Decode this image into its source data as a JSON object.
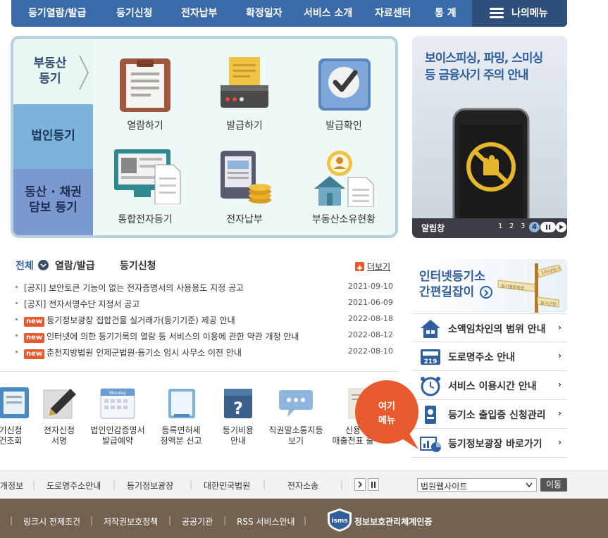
{
  "nav": {
    "items": [
      "등기열람/발급",
      "등기신청",
      "전자납부",
      "확정일자",
      "서비스 소개",
      "자료센터",
      "통 계"
    ],
    "my_menu": "나의메뉴"
  },
  "panel": {
    "tabs": {
      "real_estate": "부동산\n등기",
      "corporate": "법인등기",
      "movable": "동산 · 채권\n담보 등기"
    },
    "services": [
      "열람하기",
      "발급하기",
      "발급확인",
      "통합전자등기",
      "전자납부",
      "부동산소유현황"
    ]
  },
  "banner": {
    "headline": "보이스피싱, 파밍, 스미싱\n등 금융사기 주의 안내",
    "bar_label": "알림창",
    "pages": [
      "1",
      "2",
      "3",
      "4"
    ],
    "current_page": "4"
  },
  "notices": {
    "tabs": [
      "전체",
      "열람/발급",
      "등기신청"
    ],
    "more": "더보기",
    "new_label": "new",
    "items": [
      {
        "text": "[공지] 보안토큰 기능이 없는 전자증명서의 사용용도 지정 공고",
        "date": "2021-09-10",
        "is_new": false
      },
      {
        "text": "[공지] 전자서명수단 지정서 공고",
        "date": "2021-06-09",
        "is_new": false
      },
      {
        "text": "등기정보광장 집합건물 실거래가(등기기준) 제공 안내",
        "date": "2022-08-18",
        "is_new": true
      },
      {
        "text": "인터넷에 의한 등기기록의 열람 등 서비스의 이용에 관한 약관 개정 안내",
        "date": "2022-08-12",
        "is_new": true
      },
      {
        "text": "춘천지방법원 인제군법원·등기소 임시 사무소 이전 안내",
        "date": "2022-08-10",
        "is_new": true
      }
    ]
  },
  "guide": {
    "title": "인터넷등기소\n간편길잡이",
    "sign_texts": [
      "인터넷등기",
      "등기열람발급",
      "등기신청"
    ]
  },
  "right_links": [
    "소액임차인의 범위 안내",
    "도로명주소 안내",
    "서비스 이용시간 안내",
    "등기소 출입증 신청관리",
    "등기정보광장 바로가기"
  ],
  "bottom_icons": [
    {
      "label": "기신청\n건조회",
      "cal_text": ""
    },
    {
      "label": "전자신청\n서명",
      "cal_text": ""
    },
    {
      "label": "법인인감증명서\n발급예약",
      "cal_text": "Monday"
    },
    {
      "label": "등록면허세\n정액분 신고",
      "cal_text": ""
    },
    {
      "label": "등기비용\n안내",
      "cal_text": ""
    },
    {
      "label": "직권말소통지등\n보기",
      "cal_text": ""
    },
    {
      "label": "신용\n매출전표 출",
      "cal_text": ""
    }
  ],
  "here_menu": "여기\n메뉴",
  "footer_links": [
    "개정보",
    "도로명주소안내",
    "등기정보광장",
    "대한민국법원",
    "전자소송"
  ],
  "select": {
    "value": "법원웹사이트",
    "go": "이동"
  },
  "footer_policies": [
    "링크시 전제조건",
    "저작권보호정책",
    "공공기관",
    "RSS 서비스안내"
  ],
  "isms": {
    "logo": "isms",
    "text": "정보보호관리체계인증"
  },
  "colors": {
    "nav": "#3a6aa8",
    "my_menu": "#2e4e7c",
    "new_badge": "#e65a2e",
    "footer": "#726250",
    "link_blue": "#2f5f9f"
  }
}
